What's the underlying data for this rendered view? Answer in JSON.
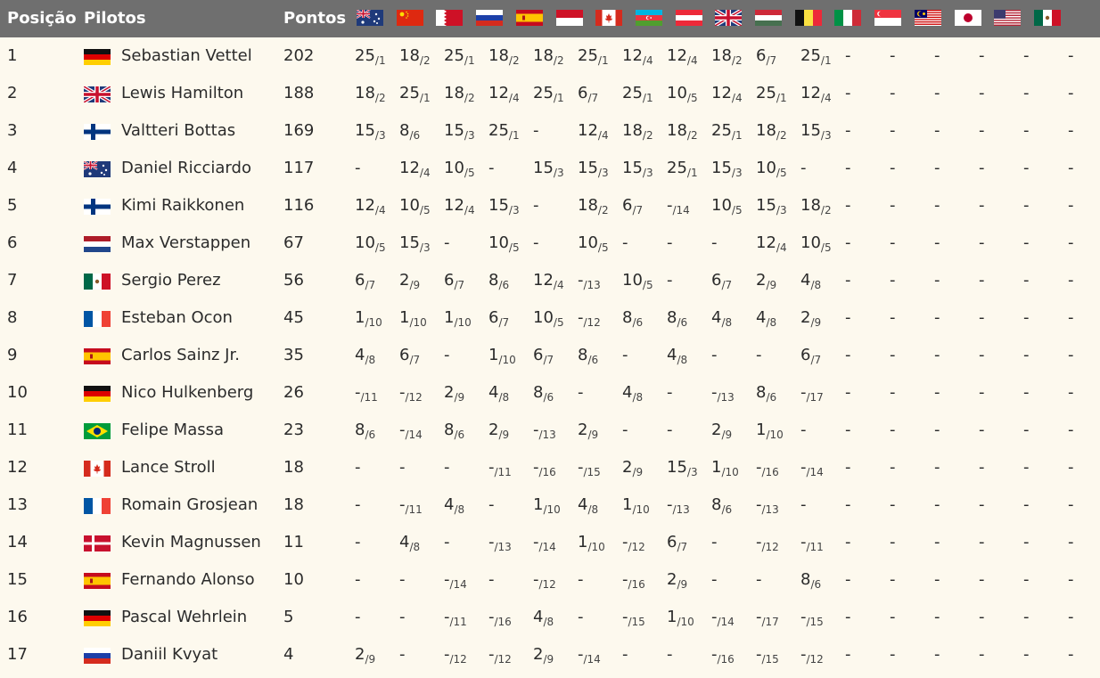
{
  "header": {
    "position_label": "Posição",
    "pilots_label": "Pilotos",
    "points_label": "Pontos",
    "race_flags": [
      "australia",
      "china",
      "bahrain",
      "russia",
      "spain",
      "monaco",
      "canada",
      "azerbaijan",
      "austria",
      "great-britain",
      "hungary",
      "belgium",
      "italy",
      "singapore",
      "malaysia",
      "japan",
      "usa",
      "mexico"
    ]
  },
  "rows": [
    {
      "pos": "1",
      "name": "Sebastian Vettel",
      "flag": "germany",
      "points": "202",
      "results": [
        [
          "25",
          "/1"
        ],
        [
          "18",
          "/2"
        ],
        [
          "25",
          "/1"
        ],
        [
          "18",
          "/2"
        ],
        [
          "18",
          "/2"
        ],
        [
          "25",
          "/1"
        ],
        [
          "12",
          "/4"
        ],
        [
          "12",
          "/4"
        ],
        [
          "18",
          "/2"
        ],
        [
          "6",
          "/7"
        ],
        [
          "25",
          "/1"
        ],
        [
          "-",
          ""
        ],
        [
          "-",
          ""
        ],
        [
          "-",
          ""
        ],
        [
          "-",
          ""
        ],
        [
          "-",
          ""
        ],
        [
          "-",
          ""
        ],
        [
          "-",
          ""
        ]
      ]
    },
    {
      "pos": "2",
      "name": "Lewis Hamilton",
      "flag": "great-britain",
      "points": "188",
      "results": [
        [
          "18",
          "/2"
        ],
        [
          "25",
          "/1"
        ],
        [
          "18",
          "/2"
        ],
        [
          "12",
          "/4"
        ],
        [
          "25",
          "/1"
        ],
        [
          "6",
          "/7"
        ],
        [
          "25",
          "/1"
        ],
        [
          "10",
          "/5"
        ],
        [
          "12",
          "/4"
        ],
        [
          "25",
          "/1"
        ],
        [
          "12",
          "/4"
        ],
        [
          "-",
          ""
        ],
        [
          "-",
          ""
        ],
        [
          "-",
          ""
        ],
        [
          "-",
          ""
        ],
        [
          "-",
          ""
        ],
        [
          "-",
          ""
        ],
        [
          "-",
          ""
        ]
      ]
    },
    {
      "pos": "3",
      "name": "Valtteri Bottas",
      "flag": "finland",
      "points": "169",
      "results": [
        [
          "15",
          "/3"
        ],
        [
          "8",
          "/6"
        ],
        [
          "15",
          "/3"
        ],
        [
          "25",
          "/1"
        ],
        [
          "-",
          ""
        ],
        [
          "12",
          "/4"
        ],
        [
          "18",
          "/2"
        ],
        [
          "18",
          "/2"
        ],
        [
          "25",
          "/1"
        ],
        [
          "18",
          "/2"
        ],
        [
          "15",
          "/3"
        ],
        [
          "-",
          ""
        ],
        [
          "-",
          ""
        ],
        [
          "-",
          ""
        ],
        [
          "-",
          ""
        ],
        [
          "-",
          ""
        ],
        [
          "-",
          ""
        ],
        [
          "-",
          ""
        ]
      ]
    },
    {
      "pos": "4",
      "name": "Daniel Ricciardo",
      "flag": "australia",
      "points": "117",
      "results": [
        [
          "-",
          ""
        ],
        [
          "12",
          "/4"
        ],
        [
          "10",
          "/5"
        ],
        [
          "-",
          ""
        ],
        [
          "15",
          "/3"
        ],
        [
          "15",
          "/3"
        ],
        [
          "15",
          "/3"
        ],
        [
          "25",
          "/1"
        ],
        [
          "15",
          "/3"
        ],
        [
          "10",
          "/5"
        ],
        [
          "-",
          ""
        ],
        [
          "-",
          ""
        ],
        [
          "-",
          ""
        ],
        [
          "-",
          ""
        ],
        [
          "-",
          ""
        ],
        [
          "-",
          ""
        ],
        [
          "-",
          ""
        ],
        [
          "-",
          ""
        ]
      ]
    },
    {
      "pos": "5",
      "name": "Kimi Raikkonen",
      "flag": "finland",
      "points": "116",
      "results": [
        [
          "12",
          "/4"
        ],
        [
          "10",
          "/5"
        ],
        [
          "12",
          "/4"
        ],
        [
          "15",
          "/3"
        ],
        [
          "-",
          ""
        ],
        [
          "18",
          "/2"
        ],
        [
          "6",
          "/7"
        ],
        [
          "-",
          "/14"
        ],
        [
          "10",
          "/5"
        ],
        [
          "15",
          "/3"
        ],
        [
          "18",
          "/2"
        ],
        [
          "-",
          ""
        ],
        [
          "-",
          ""
        ],
        [
          "-",
          ""
        ],
        [
          "-",
          ""
        ],
        [
          "-",
          ""
        ],
        [
          "-",
          ""
        ],
        [
          "-",
          ""
        ]
      ]
    },
    {
      "pos": "6",
      "name": "Max Verstappen",
      "flag": "netherlands",
      "points": "67",
      "results": [
        [
          "10",
          "/5"
        ],
        [
          "15",
          "/3"
        ],
        [
          "-",
          ""
        ],
        [
          "10",
          "/5"
        ],
        [
          "-",
          ""
        ],
        [
          "10",
          "/5"
        ],
        [
          "-",
          ""
        ],
        [
          "-",
          ""
        ],
        [
          "-",
          ""
        ],
        [
          "12",
          "/4"
        ],
        [
          "10",
          "/5"
        ],
        [
          "-",
          ""
        ],
        [
          "-",
          ""
        ],
        [
          "-",
          ""
        ],
        [
          "-",
          ""
        ],
        [
          "-",
          ""
        ],
        [
          "-",
          ""
        ],
        [
          "-",
          ""
        ]
      ]
    },
    {
      "pos": "7",
      "name": "Sergio Perez",
      "flag": "mexico",
      "points": "56",
      "results": [
        [
          "6",
          "/7"
        ],
        [
          "2",
          "/9"
        ],
        [
          "6",
          "/7"
        ],
        [
          "8",
          "/6"
        ],
        [
          "12",
          "/4"
        ],
        [
          "-",
          "/13"
        ],
        [
          "10",
          "/5"
        ],
        [
          "-",
          ""
        ],
        [
          "6",
          "/7"
        ],
        [
          "2",
          "/9"
        ],
        [
          "4",
          "/8"
        ],
        [
          "-",
          ""
        ],
        [
          "-",
          ""
        ],
        [
          "-",
          ""
        ],
        [
          "-",
          ""
        ],
        [
          "-",
          ""
        ],
        [
          "-",
          ""
        ],
        [
          "-",
          ""
        ]
      ]
    },
    {
      "pos": "8",
      "name": "Esteban Ocon",
      "flag": "france",
      "points": "45",
      "results": [
        [
          "1",
          "/10"
        ],
        [
          "1",
          "/10"
        ],
        [
          "1",
          "/10"
        ],
        [
          "6",
          "/7"
        ],
        [
          "10",
          "/5"
        ],
        [
          "-",
          "/12"
        ],
        [
          "8",
          "/6"
        ],
        [
          "8",
          "/6"
        ],
        [
          "4",
          "/8"
        ],
        [
          "4",
          "/8"
        ],
        [
          "2",
          "/9"
        ],
        [
          "-",
          ""
        ],
        [
          "-",
          ""
        ],
        [
          "-",
          ""
        ],
        [
          "-",
          ""
        ],
        [
          "-",
          ""
        ],
        [
          "-",
          ""
        ],
        [
          "-",
          ""
        ]
      ]
    },
    {
      "pos": "9",
      "name": "Carlos Sainz Jr.",
      "flag": "spain",
      "points": "35",
      "results": [
        [
          "4",
          "/8"
        ],
        [
          "6",
          "/7"
        ],
        [
          "-",
          ""
        ],
        [
          "1",
          "/10"
        ],
        [
          "6",
          "/7"
        ],
        [
          "8",
          "/6"
        ],
        [
          "-",
          ""
        ],
        [
          "4",
          "/8"
        ],
        [
          "-",
          ""
        ],
        [
          "-",
          ""
        ],
        [
          "6",
          "/7"
        ],
        [
          "-",
          ""
        ],
        [
          "-",
          ""
        ],
        [
          "-",
          ""
        ],
        [
          "-",
          ""
        ],
        [
          "-",
          ""
        ],
        [
          "-",
          ""
        ],
        [
          "-",
          ""
        ]
      ]
    },
    {
      "pos": "10",
      "name": "Nico Hulkenberg",
      "flag": "germany",
      "points": "26",
      "results": [
        [
          "-",
          "/11"
        ],
        [
          "-",
          "/12"
        ],
        [
          "2",
          "/9"
        ],
        [
          "4",
          "/8"
        ],
        [
          "8",
          "/6"
        ],
        [
          "-",
          ""
        ],
        [
          "4",
          "/8"
        ],
        [
          "-",
          ""
        ],
        [
          "-",
          "/13"
        ],
        [
          "8",
          "/6"
        ],
        [
          "-",
          "/17"
        ],
        [
          "-",
          ""
        ],
        [
          "-",
          ""
        ],
        [
          "-",
          ""
        ],
        [
          "-",
          ""
        ],
        [
          "-",
          ""
        ],
        [
          "-",
          ""
        ],
        [
          "-",
          ""
        ]
      ]
    },
    {
      "pos": "11",
      "name": "Felipe Massa",
      "flag": "brazil",
      "points": "23",
      "results": [
        [
          "8",
          "/6"
        ],
        [
          "-",
          "/14"
        ],
        [
          "8",
          "/6"
        ],
        [
          "2",
          "/9"
        ],
        [
          "-",
          "/13"
        ],
        [
          "2",
          "/9"
        ],
        [
          "-",
          ""
        ],
        [
          "-",
          ""
        ],
        [
          "2",
          "/9"
        ],
        [
          "1",
          "/10"
        ],
        [
          "-",
          ""
        ],
        [
          "-",
          ""
        ],
        [
          "-",
          ""
        ],
        [
          "-",
          ""
        ],
        [
          "-",
          ""
        ],
        [
          "-",
          ""
        ],
        [
          "-",
          ""
        ],
        [
          "-",
          ""
        ]
      ]
    },
    {
      "pos": "12",
      "name": "Lance Stroll",
      "flag": "canada",
      "points": "18",
      "results": [
        [
          "-",
          ""
        ],
        [
          "-",
          ""
        ],
        [
          "-",
          ""
        ],
        [
          "-",
          "/11"
        ],
        [
          "-",
          "/16"
        ],
        [
          "-",
          "/15"
        ],
        [
          "2",
          "/9"
        ],
        [
          "15",
          "/3"
        ],
        [
          "1",
          "/10"
        ],
        [
          "-",
          "/16"
        ],
        [
          "-",
          "/14"
        ],
        [
          "-",
          ""
        ],
        [
          "-",
          ""
        ],
        [
          "-",
          ""
        ],
        [
          "-",
          ""
        ],
        [
          "-",
          ""
        ],
        [
          "-",
          ""
        ],
        [
          "-",
          ""
        ]
      ]
    },
    {
      "pos": "13",
      "name": "Romain Grosjean",
      "flag": "france",
      "points": "18",
      "results": [
        [
          "-",
          ""
        ],
        [
          "-",
          "/11"
        ],
        [
          "4",
          "/8"
        ],
        [
          "-",
          ""
        ],
        [
          "1",
          "/10"
        ],
        [
          "4",
          "/8"
        ],
        [
          "1",
          "/10"
        ],
        [
          "-",
          "/13"
        ],
        [
          "8",
          "/6"
        ],
        [
          "-",
          "/13"
        ],
        [
          "-",
          ""
        ],
        [
          "-",
          ""
        ],
        [
          "-",
          ""
        ],
        [
          "-",
          ""
        ],
        [
          "-",
          ""
        ],
        [
          "-",
          ""
        ],
        [
          "-",
          ""
        ],
        [
          "-",
          ""
        ]
      ]
    },
    {
      "pos": "14",
      "name": "Kevin Magnussen",
      "flag": "denmark",
      "points": "11",
      "results": [
        [
          "-",
          ""
        ],
        [
          "4",
          "/8"
        ],
        [
          "-",
          ""
        ],
        [
          "-",
          "/13"
        ],
        [
          "-",
          "/14"
        ],
        [
          "1",
          "/10"
        ],
        [
          "-",
          "/12"
        ],
        [
          "6",
          "/7"
        ],
        [
          "-",
          ""
        ],
        [
          "-",
          "/12"
        ],
        [
          "-",
          "/11"
        ],
        [
          "-",
          ""
        ],
        [
          "-",
          ""
        ],
        [
          "-",
          ""
        ],
        [
          "-",
          ""
        ],
        [
          "-",
          ""
        ],
        [
          "-",
          ""
        ],
        [
          "-",
          ""
        ]
      ]
    },
    {
      "pos": "15",
      "name": "Fernando Alonso",
      "flag": "spain",
      "points": "10",
      "results": [
        [
          "-",
          ""
        ],
        [
          "-",
          ""
        ],
        [
          "-",
          "/14"
        ],
        [
          "-",
          ""
        ],
        [
          "-",
          "/12"
        ],
        [
          "-",
          ""
        ],
        [
          "-",
          "/16"
        ],
        [
          "2",
          "/9"
        ],
        [
          "-",
          ""
        ],
        [
          "-",
          ""
        ],
        [
          "8",
          "/6"
        ],
        [
          "-",
          ""
        ],
        [
          "-",
          ""
        ],
        [
          "-",
          ""
        ],
        [
          "-",
          ""
        ],
        [
          "-",
          ""
        ],
        [
          "-",
          ""
        ],
        [
          "-",
          ""
        ]
      ]
    },
    {
      "pos": "16",
      "name": "Pascal Wehrlein",
      "flag": "germany",
      "points": "5",
      "results": [
        [
          "-",
          ""
        ],
        [
          "-",
          ""
        ],
        [
          "-",
          "/11"
        ],
        [
          "-",
          "/16"
        ],
        [
          "4",
          "/8"
        ],
        [
          "-",
          ""
        ],
        [
          "-",
          "/15"
        ],
        [
          "1",
          "/10"
        ],
        [
          "-",
          "/14"
        ],
        [
          "-",
          "/17"
        ],
        [
          "-",
          "/15"
        ],
        [
          "-",
          ""
        ],
        [
          "-",
          ""
        ],
        [
          "-",
          ""
        ],
        [
          "-",
          ""
        ],
        [
          "-",
          ""
        ],
        [
          "-",
          ""
        ],
        [
          "-",
          ""
        ]
      ]
    },
    {
      "pos": "17",
      "name": "Daniil Kvyat",
      "flag": "russia",
      "points": "4",
      "results": [
        [
          "2",
          "/9"
        ],
        [
          "-",
          ""
        ],
        [
          "-",
          "/12"
        ],
        [
          "-",
          "/12"
        ],
        [
          "2",
          "/9"
        ],
        [
          "-",
          "/14"
        ],
        [
          "-",
          ""
        ],
        [
          "-",
          ""
        ],
        [
          "-",
          "/16"
        ],
        [
          "-",
          "/15"
        ],
        [
          "-",
          "/12"
        ],
        [
          "-",
          ""
        ],
        [
          "-",
          ""
        ],
        [
          "-",
          ""
        ],
        [
          "-",
          ""
        ],
        [
          "-",
          ""
        ],
        [
          "-",
          ""
        ],
        [
          "-",
          ""
        ]
      ]
    }
  ]
}
